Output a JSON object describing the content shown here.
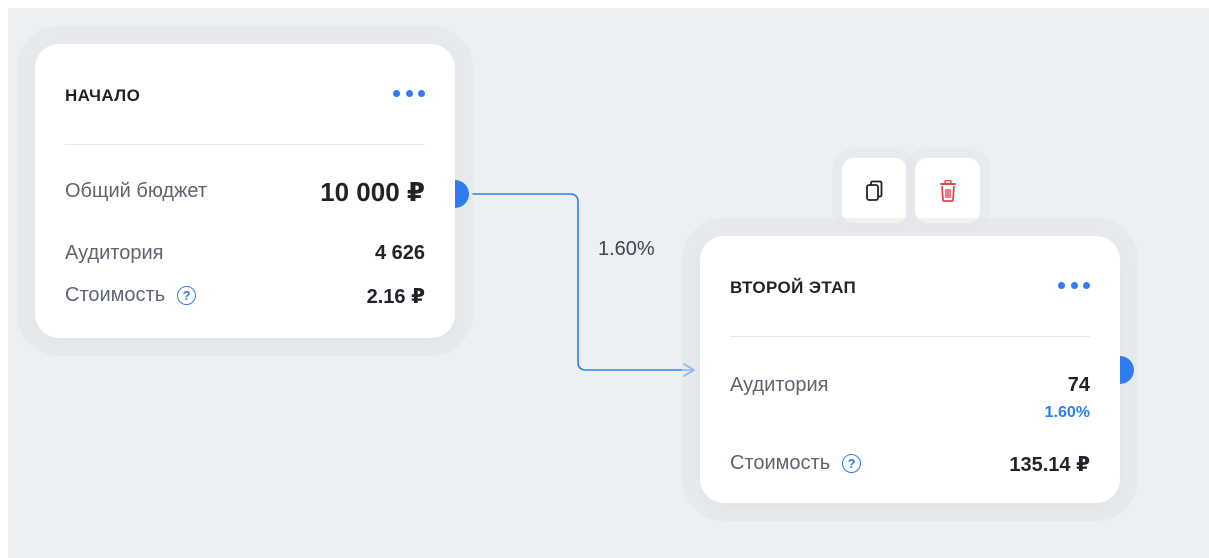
{
  "start_node": {
    "title": "НАЧАЛО",
    "more_icon": "more-dots-icon",
    "rows": [
      {
        "label": "Общий бюджет",
        "value": "10 000 ₽"
      },
      {
        "label": "Аудитория",
        "value": "4 626"
      },
      {
        "label": "Стоимость",
        "value": "2.16 ₽",
        "help": "?"
      }
    ]
  },
  "edge": {
    "label": "1.60%",
    "color": "#2f7cf0"
  },
  "toolbar": {
    "copy_icon": "copy-icon",
    "delete_icon": "trash-icon",
    "delete_color": "#e2484f"
  },
  "second_node": {
    "title": "ВТОРОЙ ЭТАП",
    "more_icon": "more-dots-icon",
    "rows": [
      {
        "label": "Аудитория",
        "value": "74",
        "sub_value": "1.60%"
      },
      {
        "label": "Стоимость",
        "value": "135.14 ₽",
        "help": "?"
      }
    ]
  },
  "colors": {
    "accent": "#2f7cf0",
    "canvas": "#edf0f2",
    "danger": "#e2484f"
  }
}
